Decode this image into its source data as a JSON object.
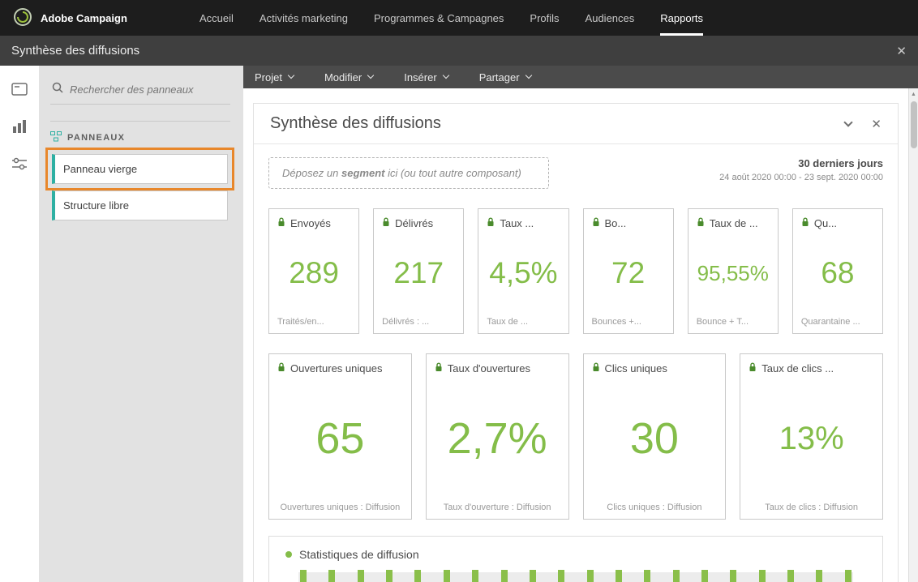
{
  "topnav": {
    "brand": "Adobe Campaign",
    "items": [
      {
        "label": "Accueil"
      },
      {
        "label": "Activités marketing"
      },
      {
        "label": "Programmes & Campagnes"
      },
      {
        "label": "Profils"
      },
      {
        "label": "Audiences"
      },
      {
        "label": "Rapports",
        "active": true
      }
    ]
  },
  "subheader": {
    "title": "Synthèse des diffusions"
  },
  "icons": {
    "close": "✕",
    "scroll_up": "▲"
  },
  "sidebar": {
    "search": {
      "placeholder": "Rechercher des panneaux"
    },
    "section_title": "PANNEAUX",
    "items": [
      {
        "label": "Panneau vierge",
        "highlighted": true
      },
      {
        "label": "Structure libre",
        "highlighted": false
      }
    ]
  },
  "toolbar": {
    "menus": [
      {
        "label": "Projet"
      },
      {
        "label": "Modifier"
      },
      {
        "label": "Insérer"
      },
      {
        "label": "Partager"
      }
    ]
  },
  "report": {
    "title": "Synthèse des diffusions",
    "dropzone": {
      "prefix": "Déposez un ",
      "emphasis": "segment",
      "suffix": " ici (ou tout autre composant)"
    },
    "period": {
      "label": "30 derniers jours",
      "range": "24 août 2020 00:00 - 23 sept. 2020 00:00"
    },
    "kpi_row1": [
      {
        "title": "Envoyés",
        "value": "289",
        "subtitle": "Traités/en..."
      },
      {
        "title": "Délivrés",
        "value": "217",
        "subtitle": "Délivrés : ..."
      },
      {
        "title": "Taux ...",
        "value": "4,5%",
        "subtitle": "Taux de  ..."
      },
      {
        "title": "Bo...",
        "value": "72",
        "subtitle": "Bounces +..."
      },
      {
        "title": "Taux de ...",
        "value": "95,55%",
        "subtitle": "Bounce + T..."
      },
      {
        "title": "Qu...",
        "value": "68",
        "subtitle": "Quarantaine ..."
      }
    ],
    "kpi_row2": [
      {
        "title": "Ouvertures uniques",
        "value": "65",
        "subtitle": "Ouvertures uniques : Diffusion"
      },
      {
        "title": "Taux d'ouvertures",
        "value": "2,7%",
        "subtitle": "Taux d'ouverture : Diffusion"
      },
      {
        "title": "Clics uniques",
        "value": "30",
        "subtitle": "Clics uniques : Diffusion"
      },
      {
        "title": "Taux de clics ...",
        "value": "13%",
        "subtitle": "Taux de clics : Diffusion"
      }
    ],
    "stats_section": {
      "title": "Statistiques de diffusion",
      "bar_count": 20
    }
  },
  "colors": {
    "accent_green": "#84bd49",
    "accent_teal": "#2eb0a3",
    "highlight_orange": "#e8872b",
    "lock_green": "#4a8b2c",
    "topnav_bg": "#1d1d1d",
    "subheader_bg": "#3f3f3f",
    "toolbar_bg": "#4b4b4b",
    "sidebar_bg": "#e2e2e2"
  }
}
